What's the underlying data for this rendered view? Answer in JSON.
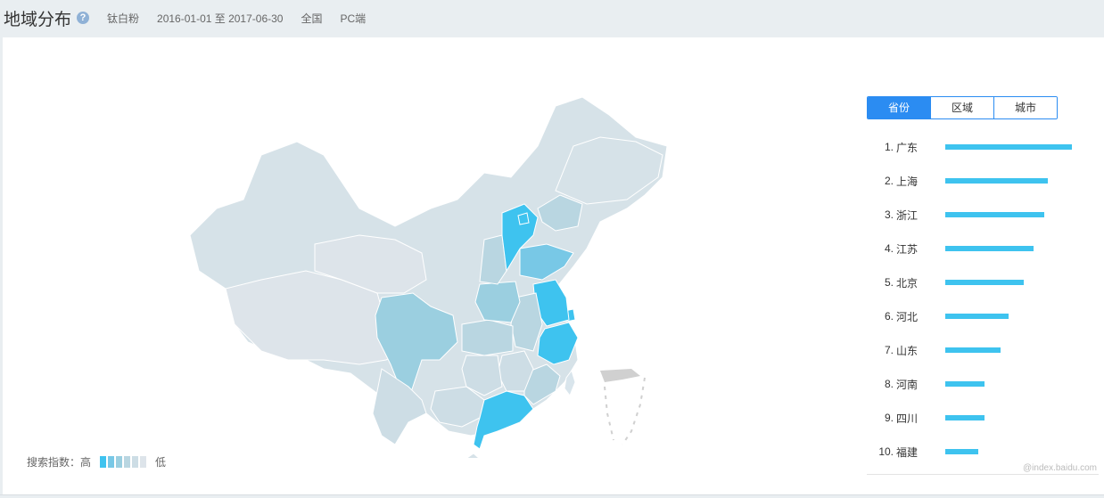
{
  "header": {
    "title": "地域分布",
    "help_icon": "question-circle-icon",
    "keyword": "钛白粉",
    "date_range": "2016-01-01 至 2017-06-30",
    "region": "全国",
    "device": "PC端"
  },
  "tabs": [
    {
      "label": "省份",
      "active": true
    },
    {
      "label": "区域",
      "active": false
    },
    {
      "label": "城市",
      "active": false
    }
  ],
  "ranking": [
    {
      "rank": "1.",
      "name": "广东",
      "value": 1.0
    },
    {
      "rank": "2.",
      "name": "上海",
      "value": 0.81
    },
    {
      "rank": "3.",
      "name": "浙江",
      "value": 0.78
    },
    {
      "rank": "4.",
      "name": "江苏",
      "value": 0.7
    },
    {
      "rank": "5.",
      "name": "北京",
      "value": 0.62
    },
    {
      "rank": "6.",
      "name": "河北",
      "value": 0.5
    },
    {
      "rank": "7.",
      "name": "山东",
      "value": 0.44
    },
    {
      "rank": "8.",
      "name": "河南",
      "value": 0.31
    },
    {
      "rank": "9.",
      "name": "四川",
      "value": 0.31
    },
    {
      "rank": "10.",
      "name": "福建",
      "value": 0.26
    }
  ],
  "legend": {
    "label": "搜索指数：高",
    "low_label": "低",
    "colors": [
      "#3ec3ef",
      "#78c8e6",
      "#9bcfe0",
      "#b9d6e1",
      "#cddde5",
      "#dde4ea"
    ]
  },
  "colors": {
    "accent": "#2b8cf2",
    "bar": "#3ec3ef",
    "map_default": "#d6e2e8",
    "taiwan": "#d9e5ec",
    "south_china_sea": "#d0d0d0"
  },
  "watermark": "@index.baidu.com"
}
